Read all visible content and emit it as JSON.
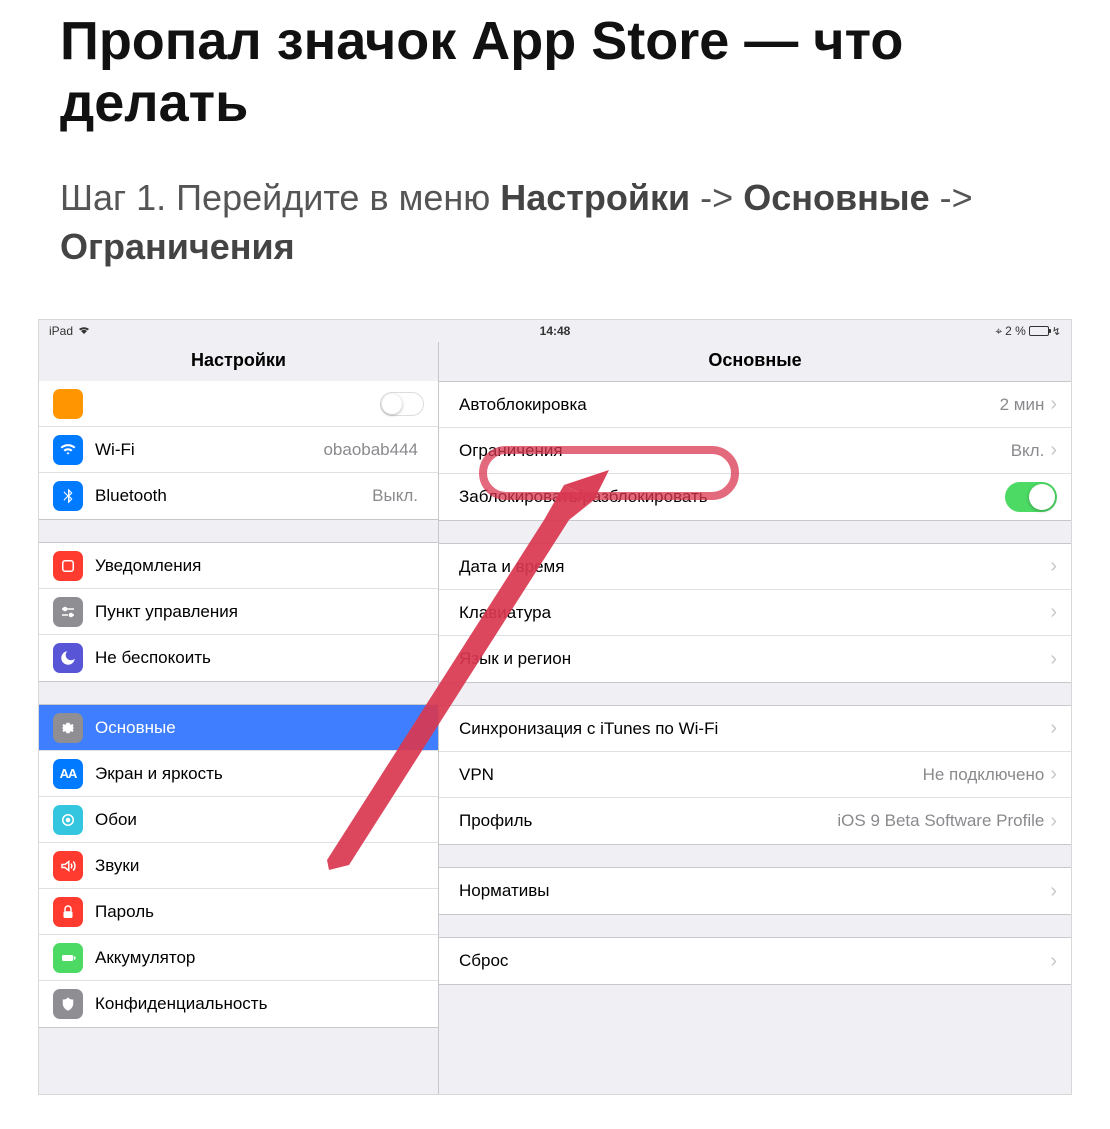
{
  "article": {
    "title": "Пропал значок App Store — что делать",
    "step_prefix": "Шаг 1. Перейдите в меню ",
    "bold1": "Настройки",
    "arrow1": " -> ",
    "bold2": "Основные",
    "arrow2": " -> ",
    "bold3": "Ограничения"
  },
  "statusbar": {
    "device": "iPad",
    "time": "14:48",
    "loc": "⌖",
    "battery": "2 %",
    "charging": "↯"
  },
  "left": {
    "title": "Настройки",
    "wifi": {
      "label": "Wi-Fi",
      "value": "obaobab444"
    },
    "bt": {
      "label": "Bluetooth",
      "value": "Выкл."
    },
    "notif": "Уведомления",
    "cc": "Пункт управления",
    "dnd": "Не беспокоить",
    "gen": "Основные",
    "disp": "Экран и яркость",
    "wall": "Обои",
    "sound": "Звуки",
    "pass": "Пароль",
    "batt": "Аккумулятор",
    "priv": "Конфиденциальность"
  },
  "right": {
    "title": "Основные",
    "autolock": {
      "label": "Автоблокировка",
      "value": "2 мин"
    },
    "restrict": {
      "label": "Ограничения",
      "value": "Вкл."
    },
    "lockunlock": "Заблокировать/разблокировать",
    "datetime": "Дата и время",
    "keyboard": "Клавиатура",
    "lang": "Язык и регион",
    "itunes": "Синхронизация с iTunes по Wi-Fi",
    "vpn": {
      "label": "VPN",
      "value": "Не подключено"
    },
    "profile": {
      "label": "Профиль",
      "value": "iOS 9 Beta Software Profile"
    },
    "regulatory": "Нормативы",
    "reset": "Сброс"
  }
}
